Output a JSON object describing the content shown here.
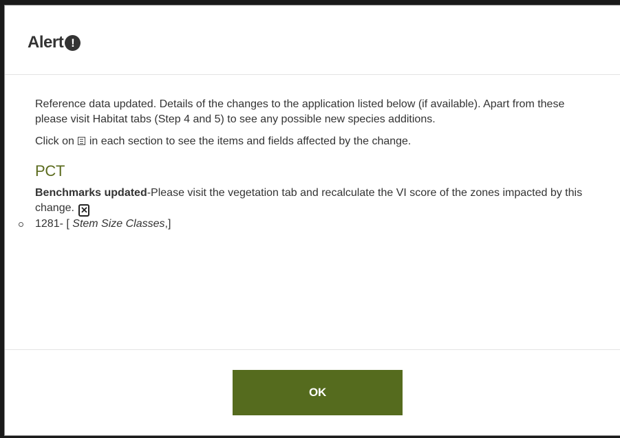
{
  "dialog": {
    "title": "Alert",
    "title_icon": "exclamation-circle-icon",
    "accent_color": "#5b6b1e",
    "button_color": "#556b1e"
  },
  "body": {
    "intro": "Reference data updated. Details of the changes to the application listed below (if available). Apart from these please visit Habitat tabs (Step 4 and 5) to see any possible new species additions.",
    "instruction_before": "Click on",
    "instruction_icon": "list-icon",
    "instruction_after": "in each section to see the items and fields affected by the change.",
    "section_title": "PCT",
    "benchmark_label": "Benchmarks updated",
    "benchmark_text": "-Please visit the vegetation tab and recalculate the VI score of the zones impacted by this change.",
    "close_icon": "close-icon",
    "changes": [
      {
        "code": "1281- [ ",
        "field": "Stem Size Classes",
        "suffix": ",]"
      }
    ]
  },
  "footer": {
    "ok_label": "OK"
  }
}
